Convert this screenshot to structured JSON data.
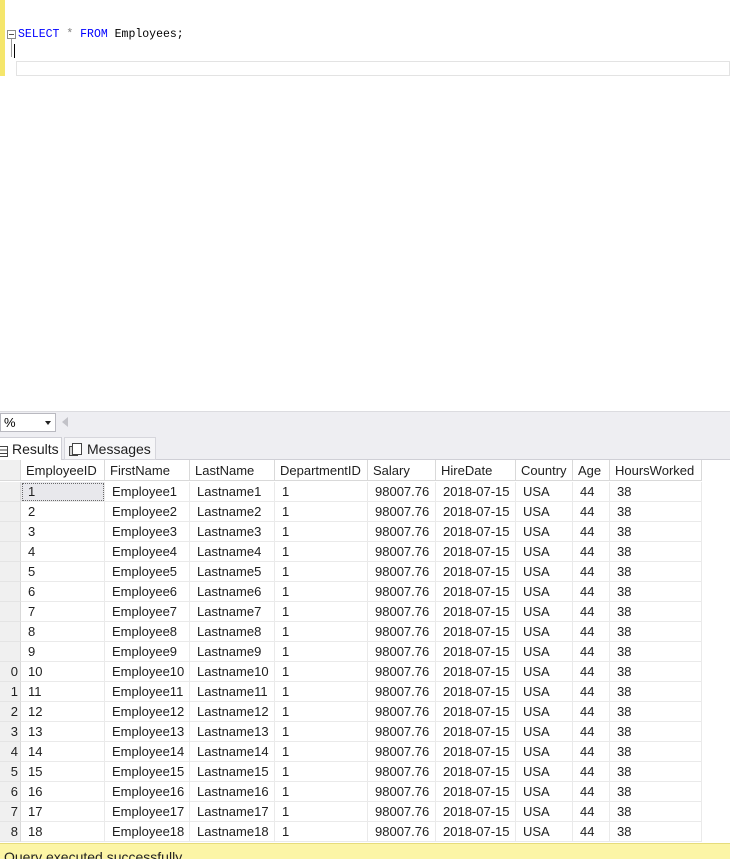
{
  "editor": {
    "tokens": [
      "SELECT",
      "*",
      "FROM",
      "Employees;"
    ]
  },
  "zoom": {
    "value": "%"
  },
  "tabs": {
    "results_label": "Results",
    "messages_label": "Messages"
  },
  "grid": {
    "columns": [
      "EmployeeID",
      "FirstName",
      "LastName",
      "DepartmentID",
      "Salary",
      "HireDate",
      "Country",
      "Age",
      "HoursWorked"
    ],
    "row_numbers": [
      "",
      "",
      "",
      "",
      "",
      "",
      "",
      "",
      "",
      "0",
      "1",
      "2",
      "3",
      "4",
      "5",
      "6",
      "7",
      "8"
    ],
    "rows": [
      [
        "1",
        "Employee1",
        "Lastname1",
        "1",
        "98007.76",
        "2018-07-15",
        "USA",
        "44",
        "38"
      ],
      [
        "2",
        "Employee2",
        "Lastname2",
        "1",
        "98007.76",
        "2018-07-15",
        "USA",
        "44",
        "38"
      ],
      [
        "3",
        "Employee3",
        "Lastname3",
        "1",
        "98007.76",
        "2018-07-15",
        "USA",
        "44",
        "38"
      ],
      [
        "4",
        "Employee4",
        "Lastname4",
        "1",
        "98007.76",
        "2018-07-15",
        "USA",
        "44",
        "38"
      ],
      [
        "5",
        "Employee5",
        "Lastname5",
        "1",
        "98007.76",
        "2018-07-15",
        "USA",
        "44",
        "38"
      ],
      [
        "6",
        "Employee6",
        "Lastname6",
        "1",
        "98007.76",
        "2018-07-15",
        "USA",
        "44",
        "38"
      ],
      [
        "7",
        "Employee7",
        "Lastname7",
        "1",
        "98007.76",
        "2018-07-15",
        "USA",
        "44",
        "38"
      ],
      [
        "8",
        "Employee8",
        "Lastname8",
        "1",
        "98007.76",
        "2018-07-15",
        "USA",
        "44",
        "38"
      ],
      [
        "9",
        "Employee9",
        "Lastname9",
        "1",
        "98007.76",
        "2018-07-15",
        "USA",
        "44",
        "38"
      ],
      [
        "10",
        "Employee10",
        "Lastname10",
        "1",
        "98007.76",
        "2018-07-15",
        "USA",
        "44",
        "38"
      ],
      [
        "11",
        "Employee11",
        "Lastname11",
        "1",
        "98007.76",
        "2018-07-15",
        "USA",
        "44",
        "38"
      ],
      [
        "12",
        "Employee12",
        "Lastname12",
        "1",
        "98007.76",
        "2018-07-15",
        "USA",
        "44",
        "38"
      ],
      [
        "13",
        "Employee13",
        "Lastname13",
        "1",
        "98007.76",
        "2018-07-15",
        "USA",
        "44",
        "38"
      ],
      [
        "14",
        "Employee14",
        "Lastname14",
        "1",
        "98007.76",
        "2018-07-15",
        "USA",
        "44",
        "38"
      ],
      [
        "15",
        "Employee15",
        "Lastname15",
        "1",
        "98007.76",
        "2018-07-15",
        "USA",
        "44",
        "38"
      ],
      [
        "16",
        "Employee16",
        "Lastname16",
        "1",
        "98007.76",
        "2018-07-15",
        "USA",
        "44",
        "38"
      ],
      [
        "17",
        "Employee17",
        "Lastname17",
        "1",
        "98007.76",
        "2018-07-15",
        "USA",
        "44",
        "38"
      ],
      [
        "18",
        "Employee18",
        "Lastname18",
        "1",
        "98007.76",
        "2018-07-15",
        "USA",
        "44",
        "38"
      ]
    ]
  },
  "status": {
    "message": "Query executed successfully."
  },
  "colors": {
    "keyword": "#0000ff",
    "operator": "#808080",
    "status_bar": "#fcf5a6",
    "editor_margin": "#f5e66b"
  }
}
